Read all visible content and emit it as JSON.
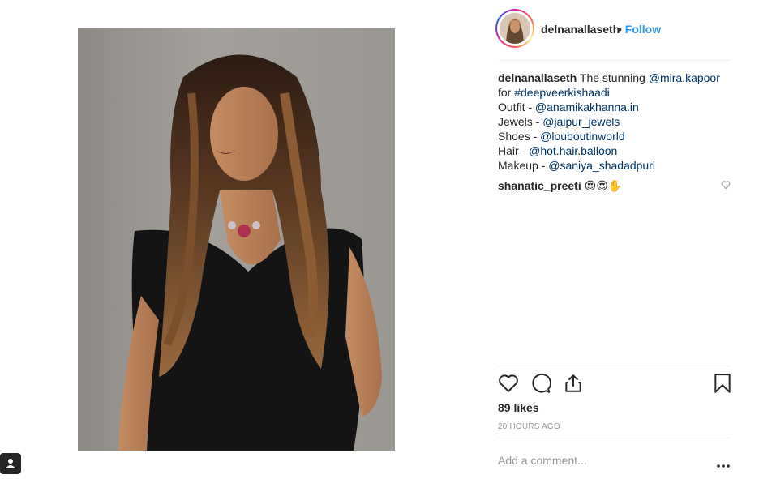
{
  "post": {
    "username": "delnanallaseth",
    "dot": "•",
    "follow_label": "Follow",
    "caption": {
      "username": "delnanallaseth",
      "line1_text": " The stunning ",
      "line1_mention": "@mira.kapoor",
      "line2_text": "for ",
      "line2_tag": "#deepveerkishaadi",
      "credits": [
        {
          "label": "Outfit - ",
          "handle": "@anamikakhanna.in"
        },
        {
          "label": "Jewels - ",
          "handle": "@jaipur_jewels"
        },
        {
          "label": "Shoes - ",
          "handle": "@louboutinworld"
        },
        {
          "label": "Hair - ",
          "handle": "@hot.hair.balloon"
        },
        {
          "label": "Makeup - ",
          "handle": "@saniya_shadadpuri"
        }
      ]
    },
    "comment": {
      "username": "shanatic_preeti",
      "text": "😍😍✋"
    },
    "likes": "89 likes",
    "timestamp": "20 HOURS AGO",
    "add_comment_placeholder": "Add a comment...",
    "more_label": "•••"
  },
  "icons": {
    "like": "heart-icon",
    "comment": "comment-bubble-icon",
    "share": "share-icon",
    "save": "bookmark-icon",
    "comment_like": "heart-small-icon",
    "badge": "user-badge-icon"
  },
  "colors": {
    "link": "#003569",
    "follow": "#3897f0",
    "muted": "#999999",
    "text": "#262626"
  }
}
